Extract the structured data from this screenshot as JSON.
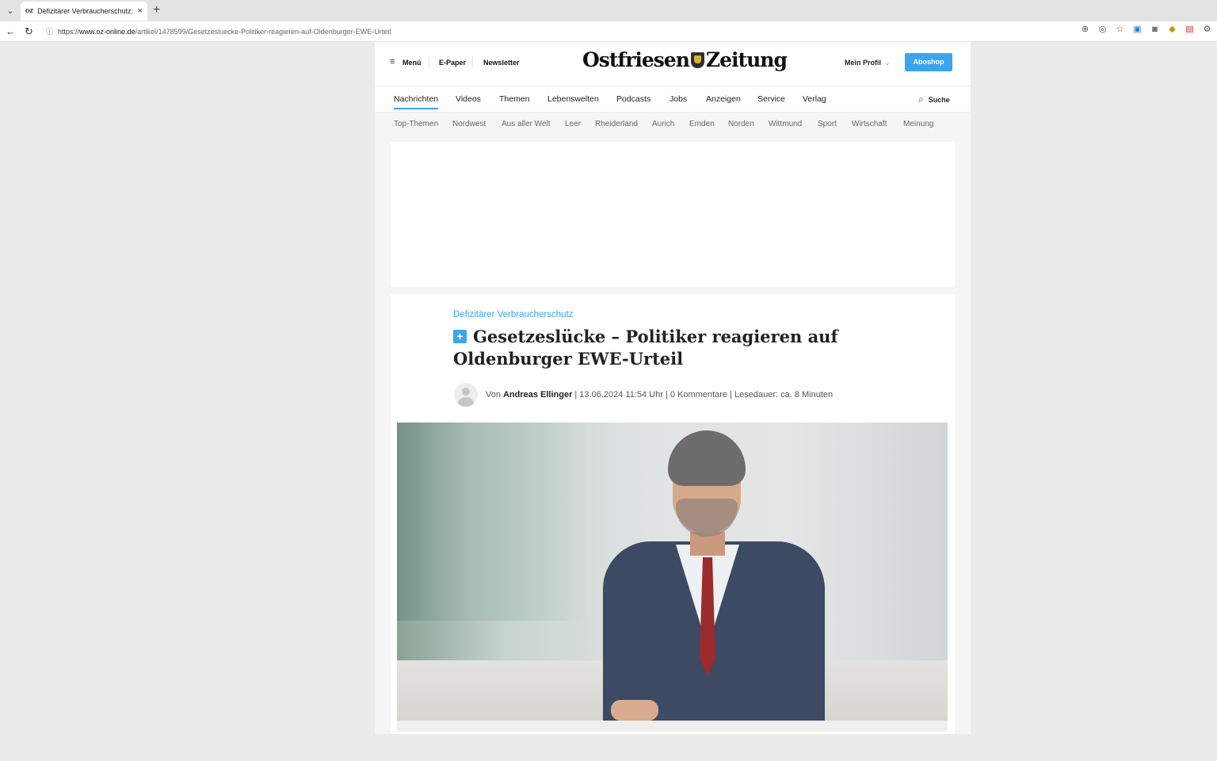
{
  "browser": {
    "tab": {
      "favicon_text": "OZ",
      "title": "Defizitärer Verbraucherschutz: Ge",
      "close": "×"
    },
    "new_tab": "+",
    "url": {
      "prefix": "https://",
      "host": "www.oz-online.de",
      "path": "/artikel/1478599/Gesetzesluecke-Politiker-reagieren-auf-Oldenburger-EWE-Urteil"
    },
    "nav": {
      "back": "←",
      "reload": "↻"
    },
    "tools": [
      "zoom-icon",
      "reader-icon",
      "star-icon",
      "sync-icon",
      "screenshot-icon",
      "extension-icon",
      "shield-icon",
      "settings-icon"
    ]
  },
  "site": {
    "menu_label": "Menü",
    "epaper_label": "E-Paper",
    "newsletter_label": "Newsletter",
    "logo_left": "Ostfriesen",
    "logo_right": "Zeitung",
    "profile_label": "Mein Profil",
    "aboshop_label": "Aboshop",
    "search_label": "Suche",
    "accent_color": "#3aa5ee"
  },
  "main_nav": [
    "Nachrichten",
    "Videos",
    "Themen",
    "Lebenswelten",
    "Podcasts",
    "Jobs",
    "Anzeigen",
    "Service",
    "Verlag"
  ],
  "sub_nav": [
    "Top-Themen",
    "Nordwest",
    "Aus aller Welt",
    "Leer",
    "Rheiderland",
    "Aurich",
    "Emden",
    "Norden",
    "Wittmund",
    "Sport",
    "Wirtschaft",
    "Meinung"
  ],
  "article": {
    "kicker": "Defizitärer Verbraucherschutz",
    "plus_badge": "+",
    "headline": "Gesetzeslücke – Politiker reagieren auf Oldenburger EWE-Urteil",
    "byline_prefix": "Von",
    "author": "Andreas Ellinger",
    "meta": "| 13.06.2024 11:54 Uhr | 0 Kommentare | Lesedauer: ca. 8 Minuten"
  }
}
